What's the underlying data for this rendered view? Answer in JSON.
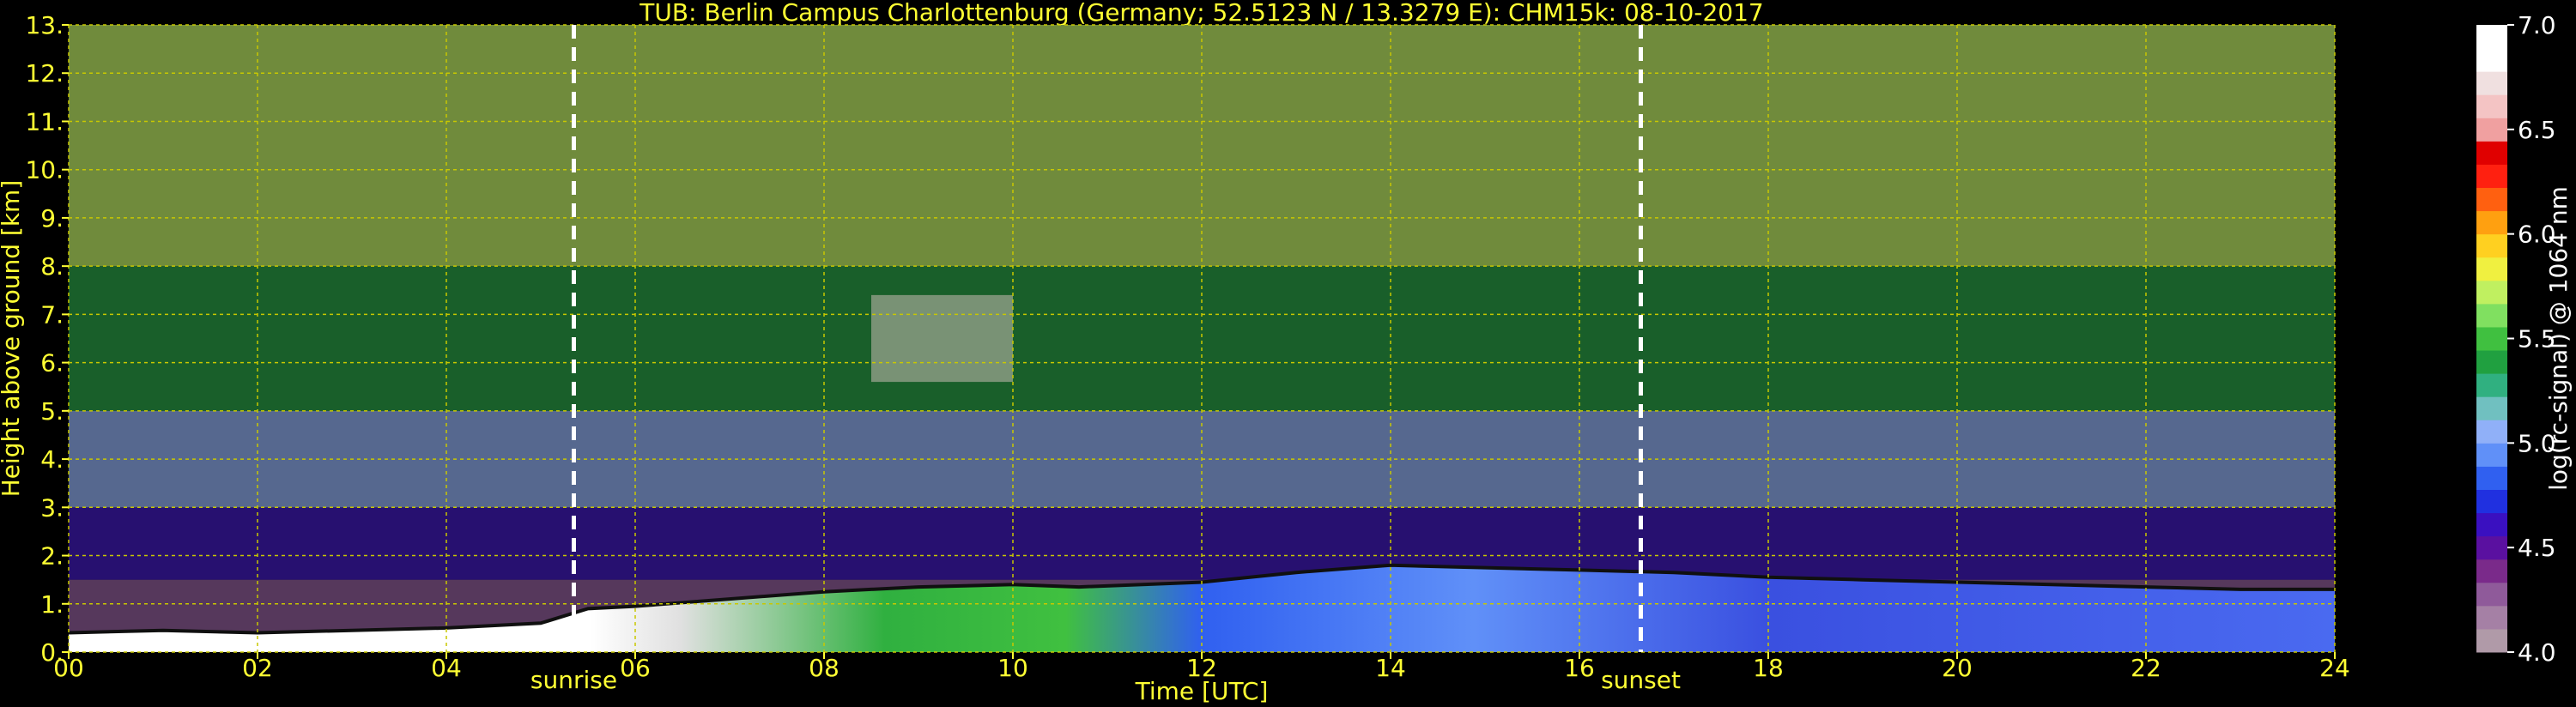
{
  "chart_data": {
    "type": "heatmap",
    "title": "TUB: Berlin Campus Charlottenburg (Germany; 52.5123 N / 13.3279 E):    CHM15k: 08-10-2017",
    "xlabel": "Time [UTC]",
    "ylabel": "Height above ground [km]",
    "xlim": [
      0,
      24
    ],
    "ylim": [
      0,
      13
    ],
    "x_ticks": [
      0,
      2,
      4,
      6,
      8,
      10,
      12,
      14,
      16,
      18,
      20,
      22,
      24
    ],
    "x_tick_labels": [
      "00",
      "02",
      "04",
      "06",
      "08",
      "10",
      "12",
      "14",
      "16",
      "18",
      "20",
      "22",
      "24"
    ],
    "y_ticks": [
      0,
      1,
      2,
      3,
      4,
      5,
      6,
      7,
      8,
      9,
      10,
      11,
      12,
      13
    ],
    "y_tick_labels": [
      "0.",
      "1.",
      "2.",
      "3.",
      "4.",
      "5.",
      "6.",
      "7.",
      "8.",
      "9.",
      "10.",
      "11.",
      "12.",
      "13."
    ],
    "grid": true,
    "colorbar": {
      "label": "log(rc-signal) @ 1064 nm",
      "range": [
        4.0,
        7.0
      ],
      "ticks": [
        4.0,
        4.5,
        5.0,
        5.5,
        6.0,
        6.5,
        7.0
      ],
      "tick_labels": [
        "4.0",
        "4.5",
        "5.0",
        "5.5",
        "6.0",
        "6.5",
        "7.0"
      ],
      "colors": [
        "#b09aa8",
        "#a580a5",
        "#8f5a9a",
        "#7a2a8a",
        "#5a10a0",
        "#3a10c0",
        "#2030e0",
        "#3060f0",
        "#6090f8",
        "#90b0f8",
        "#70c0c0",
        "#30b080",
        "#20a040",
        "#40c040",
        "#80e060",
        "#c0f060",
        "#f0f040",
        "#ffd020",
        "#ffa010",
        "#ff6010",
        "#ff2010",
        "#e00000",
        "#f0a0a0",
        "#f4c4c4",
        "#f0e0e0",
        "#ffffff",
        "#ffffff"
      ]
    },
    "annotations": [
      {
        "x": 5.35,
        "label": "sunrise"
      },
      {
        "x": 16.65,
        "label": "sunset"
      }
    ],
    "background_layers": [
      {
        "height_range": [
          0,
          1.5
        ],
        "log_signal": 4.3
      },
      {
        "height_range": [
          1.5,
          3
        ],
        "log_signal": 4.6
      },
      {
        "height_range": [
          3,
          5
        ],
        "log_signal": 5.0
      },
      {
        "height_range": [
          5,
          8
        ],
        "log_signal": 5.4
      },
      {
        "height_range": [
          8,
          13
        ],
        "log_signal": 5.7
      }
    ],
    "boundary_layer": {
      "time": [
        0,
        1,
        2,
        3,
        4,
        5,
        5.5,
        6,
        7,
        8,
        9,
        10,
        10.7,
        12,
        13,
        14,
        15,
        16,
        17,
        18,
        19,
        20,
        21,
        22,
        23,
        24
      ],
      "top_km": [
        0.4,
        0.45,
        0.4,
        0.45,
        0.5,
        0.6,
        0.9,
        0.95,
        1.1,
        1.25,
        1.35,
        1.4,
        1.35,
        1.45,
        1.65,
        1.8,
        1.75,
        1.7,
        1.65,
        1.55,
        1.5,
        1.45,
        1.4,
        1.35,
        1.3,
        1.3
      ]
    },
    "cirrus_cloud": {
      "time_range": [
        8.5,
        10
      ],
      "height_range": [
        5.6,
        7.4
      ]
    }
  }
}
